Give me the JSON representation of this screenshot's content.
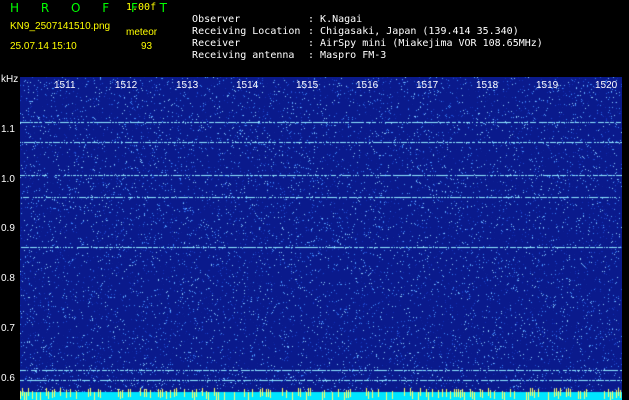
{
  "header": {
    "brand": "H R O F F T",
    "version": "1.00f",
    "filename": "KN9_2507141510.png",
    "meteors_label": "meteor",
    "datetime": "25.07.14 15:10",
    "meteors_count": "93"
  },
  "info": [
    {
      "key": "Observer",
      "value": "K.Nagai"
    },
    {
      "key": "Receiving Location",
      "value": "Chigasaki, Japan (139.414 35.340)"
    },
    {
      "key": "Receiver",
      "value": "AirSpy mini (Miakejima VOR 108.65MHz)"
    },
    {
      "key": "Receiving antenna",
      "value": "Maspro FM-3"
    }
  ],
  "axes": {
    "y_unit": "kHz",
    "y_ticks": [
      "1.1",
      "1.0",
      "0.9",
      "0.8",
      "0.7",
      "0.6"
    ],
    "x_ticks": [
      "1511",
      "1512",
      "1513",
      "1514",
      "1515",
      "1516",
      "1517",
      "1518",
      "1519",
      "1520"
    ]
  },
  "colors": {
    "background": "#000000",
    "brand": "#00ff00",
    "meta": "#ffff00",
    "info": "#ffffff",
    "waterfall_base": "#0a1a8c",
    "waterfall_noise": "#3f8cff",
    "carrier_line": "#8fe8ff",
    "bottom_band": "#00e5ff"
  }
}
